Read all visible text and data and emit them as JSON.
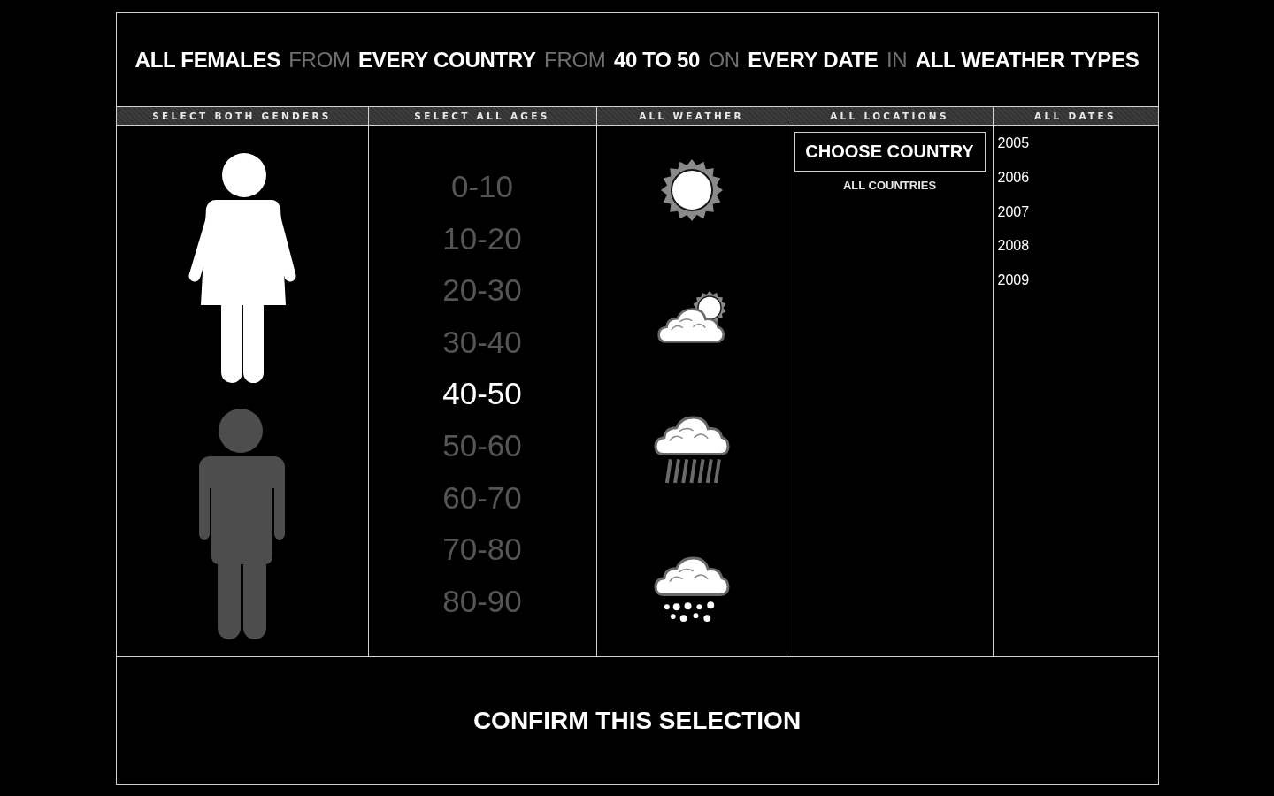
{
  "summary": [
    {
      "text": "ALL FEMALES",
      "kind": "value"
    },
    {
      "text": "FROM",
      "kind": "connector"
    },
    {
      "text": "EVERY COUNTRY",
      "kind": "value"
    },
    {
      "text": "FROM",
      "kind": "connector"
    },
    {
      "text": "40 TO 50",
      "kind": "value"
    },
    {
      "text": "ON",
      "kind": "connector"
    },
    {
      "text": "EVERY DATE",
      "kind": "value"
    },
    {
      "text": "IN",
      "kind": "connector"
    },
    {
      "text": "ALL WEATHER TYPES",
      "kind": "value"
    }
  ],
  "genders": {
    "header": "SELECT BOTH GENDERS",
    "items": [
      {
        "kind": "female",
        "selected": true
      },
      {
        "kind": "male",
        "selected": false
      }
    ]
  },
  "ages": {
    "header": "SELECT ALL AGES",
    "items": [
      {
        "label": "0-10",
        "selected": false
      },
      {
        "label": "10-20",
        "selected": false
      },
      {
        "label": "20-30",
        "selected": false
      },
      {
        "label": "30-40",
        "selected": false
      },
      {
        "label": "40-50",
        "selected": true
      },
      {
        "label": "50-60",
        "selected": false
      },
      {
        "label": "60-70",
        "selected": false
      },
      {
        "label": "70-80",
        "selected": false
      },
      {
        "label": "80-90",
        "selected": false
      }
    ]
  },
  "weather": {
    "header": "ALL WEATHER",
    "items": [
      {
        "kind": "sun"
      },
      {
        "kind": "partial"
      },
      {
        "kind": "rain"
      },
      {
        "kind": "snow"
      }
    ]
  },
  "locations": {
    "header": "ALL LOCATIONS",
    "button": "CHOOSE COUNTRY",
    "selection": "ALL COUNTRIES"
  },
  "dates": {
    "header": "ALL DATES",
    "items": [
      "2005",
      "2006",
      "2007",
      "2008",
      "2009"
    ]
  },
  "confirm": "CONFIRM THIS SELECTION"
}
